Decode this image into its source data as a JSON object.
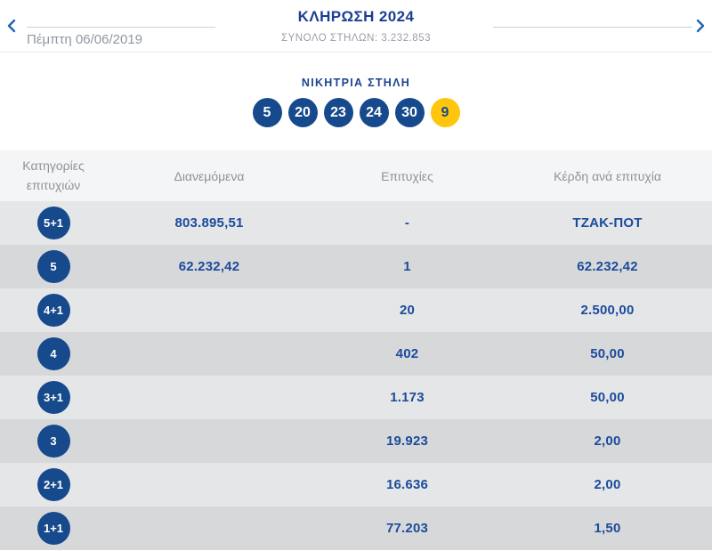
{
  "header": {
    "title": "ΚΛΗΡΩΣΗ 2024",
    "subtitle": "ΣΥΝΟΛΟ ΣΤΗΛΩΝ: 3.232.853",
    "date": "Πέμπτη 06/06/2019",
    "prev_icon": "chevron-left",
    "next_icon": "chevron-right"
  },
  "winning": {
    "title": "ΝΙΚΗΤΡΙΑ ΣΤΗΛΗ",
    "numbers": [
      "5",
      "20",
      "23",
      "24",
      "30"
    ],
    "bonus": "9"
  },
  "table": {
    "columns": {
      "category": "Κατηγορίες επιτυχιών",
      "distributed": "Διανεμόμενα",
      "winners": "Επιτυχίες",
      "prize": "Κέρδη ανά επιτυχία"
    },
    "rows": [
      {
        "category": "5+1",
        "distributed": "803.895,51",
        "winners": "-",
        "prize": "ΤΖΑΚ-ΠΟΤ"
      },
      {
        "category": "5",
        "distributed": "62.232,42",
        "winners": "1",
        "prize": "62.232,42"
      },
      {
        "category": "4+1",
        "distributed": "",
        "winners": "20",
        "prize": "2.500,00"
      },
      {
        "category": "4",
        "distributed": "",
        "winners": "402",
        "prize": "50,00"
      },
      {
        "category": "3+1",
        "distributed": "",
        "winners": "1.173",
        "prize": "50,00"
      },
      {
        "category": "3",
        "distributed": "",
        "winners": "19.923",
        "prize": "2,00"
      },
      {
        "category": "2+1",
        "distributed": "",
        "winners": "16.636",
        "prize": "2,00"
      },
      {
        "category": "1+1",
        "distributed": "",
        "winners": "77.203",
        "prize": "1,50"
      }
    ]
  },
  "colors": {
    "ball_blue": "#174a8c",
    "ball_yellow": "#ffc60d",
    "title_navy": "#1c3e92",
    "value_blue": "#1b4b9b",
    "muted_gray": "#8d939c",
    "row_light": "#e5e6e8",
    "row_dark": "#d7d8da",
    "header_row_bg": "#f4f5f6"
  }
}
